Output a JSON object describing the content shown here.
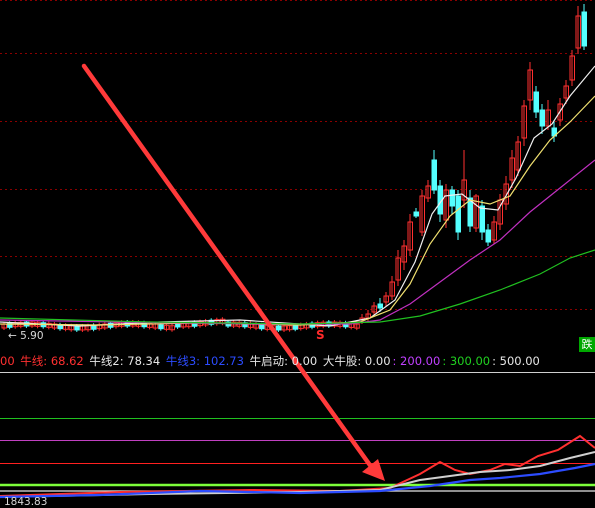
{
  "chart": {
    "low_price_label": "5.90",
    "bottom_value_label": "1843.83",
    "signal_mark": "S",
    "tag_fall": "跌"
  },
  "indicator": {
    "prefix": "00",
    "items": [
      {
        "label": "牛线",
        "value": "68.62",
        "color": "#ff3030"
      },
      {
        "label": "牛线2",
        "value": "78.34",
        "color": "#e6e6e6"
      },
      {
        "label": "牛线3",
        "value": "102.73",
        "color": "#2c4cff"
      },
      {
        "label": "牛启动",
        "value": "0.00",
        "color": "#e6e6e6"
      },
      {
        "label": "大牛股",
        "value": "0.00",
        "color": "#e6e6e6"
      },
      {
        "label": "",
        "value": "200.00",
        "color": "#c040ff"
      },
      {
        "label": "",
        "value": "300.00",
        "color": "#20d020"
      },
      {
        "label": "",
        "value": "500.00",
        "color": "#e6e6e6"
      }
    ]
  },
  "colors": {
    "up": "#ff3030",
    "down": "#54ffff",
    "ma_white": "#f0f0f0",
    "ma_yellow": "#f0e070",
    "ma_magenta": "#c030c0",
    "ma_green": "#20c020",
    "arrow": "#ff3a3a"
  }
}
